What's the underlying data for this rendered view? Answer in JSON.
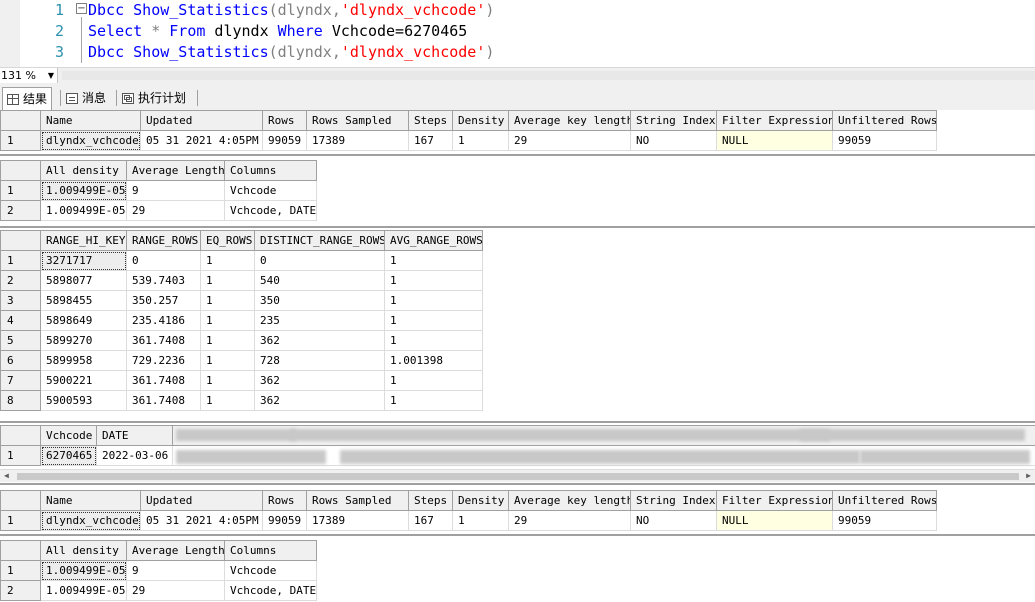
{
  "editor": {
    "line_numbers": [
      "1",
      "2",
      "3"
    ],
    "fold_glyph": "−",
    "lines": [
      [
        {
          "t": "Dbcc Show_Statistics",
          "c": "blue"
        },
        {
          "t": "(dlyndx,",
          "c": "gray"
        },
        {
          "t": "'dlyndx_vchcode'",
          "c": "red"
        },
        {
          "t": ")",
          "c": "gray"
        }
      ],
      [
        {
          "t": "Select",
          "c": "blue"
        },
        {
          "t": " * ",
          "c": "gray"
        },
        {
          "t": "From",
          "c": "blue"
        },
        {
          "t": " dlyndx ",
          "c": "black"
        },
        {
          "t": "Where",
          "c": "blue"
        },
        {
          "t": " Vchcode=6270465",
          "c": "black"
        }
      ],
      [
        {
          "t": "Dbcc Show_Statistics",
          "c": "blue"
        },
        {
          "t": "(dlyndx,",
          "c": "gray"
        },
        {
          "t": "'dlyndx_vchcode'",
          "c": "red"
        },
        {
          "t": ")",
          "c": "gray"
        }
      ]
    ]
  },
  "zoom": {
    "value": "131 %",
    "arrow": "▼"
  },
  "tabs": [
    {
      "label": "结果",
      "icon": "grid-icon",
      "active": true
    },
    {
      "label": "消息",
      "icon": "message-icon",
      "active": false
    },
    {
      "label": "执行计划",
      "icon": "execution-plan-icon",
      "active": false
    }
  ],
  "colors": {
    "null_cell": "#ffffe1",
    "header_bg": "#f0f0f0",
    "keyword": "#0000ff",
    "string": "#ff0000"
  },
  "grids": {
    "header1": {
      "columns": [
        "Name",
        "Updated",
        "Rows",
        "Rows Sampled",
        "Steps",
        "Density",
        "Average key length",
        "String Index",
        "Filter Expression",
        "Unfiltered Rows"
      ],
      "rows": [
        [
          "dlyndx_vchcode",
          "05 31 2021  4:05PM",
          "99059",
          "17389",
          "167",
          "1",
          "29",
          "NO",
          "NULL",
          "99059"
        ]
      ]
    },
    "density1": {
      "columns": [
        "All density",
        "Average Length",
        "Columns"
      ],
      "rows": [
        [
          "1.009499E-05",
          "9",
          "Vchcode"
        ],
        [
          "1.009499E-05",
          "29",
          "Vchcode, DATE"
        ]
      ]
    },
    "histogram": {
      "columns": [
        "RANGE_HI_KEY",
        "RANGE_ROWS",
        "EQ_ROWS",
        "DISTINCT_RANGE_ROWS",
        "AVG_RANGE_ROWS"
      ],
      "rows": [
        [
          "3271717",
          "0",
          "1",
          "0",
          "1"
        ],
        [
          "5898077",
          "539.7403",
          "1",
          "540",
          "1"
        ],
        [
          "5898455",
          "350.257",
          "1",
          "350",
          "1"
        ],
        [
          "5898649",
          "235.4186",
          "1",
          "235",
          "1"
        ],
        [
          "5899270",
          "361.7408",
          "1",
          "362",
          "1"
        ],
        [
          "5899958",
          "729.2236",
          "1",
          "728",
          "1.001398"
        ],
        [
          "5900221",
          "361.7408",
          "1",
          "362",
          "1"
        ],
        [
          "5900593",
          "361.7408",
          "1",
          "362",
          "1"
        ]
      ]
    },
    "select": {
      "columns": [
        "Vchcode",
        "DATE"
      ],
      "rows": [
        [
          "6270465",
          "2022-03-06"
        ]
      ]
    },
    "header2": {
      "columns": [
        "Name",
        "Updated",
        "Rows",
        "Rows Sampled",
        "Steps",
        "Density",
        "Average key length",
        "String Index",
        "Filter Expression",
        "Unfiltered Rows"
      ],
      "rows": [
        [
          "dlyndx_vchcode",
          "05 31 2021  4:05PM",
          "99059",
          "17389",
          "167",
          "1",
          "29",
          "NO",
          "NULL",
          "99059"
        ]
      ]
    },
    "density2": {
      "columns": [
        "All density",
        "Average Length",
        "Columns"
      ],
      "rows": [
        [
          "1.009499E-05",
          "9",
          "Vchcode"
        ],
        [
          "1.009499E-05",
          "29",
          "Vchcode, DATE"
        ]
      ]
    }
  },
  "scroll_arrows": {
    "left": "◀",
    "right": "▶"
  }
}
